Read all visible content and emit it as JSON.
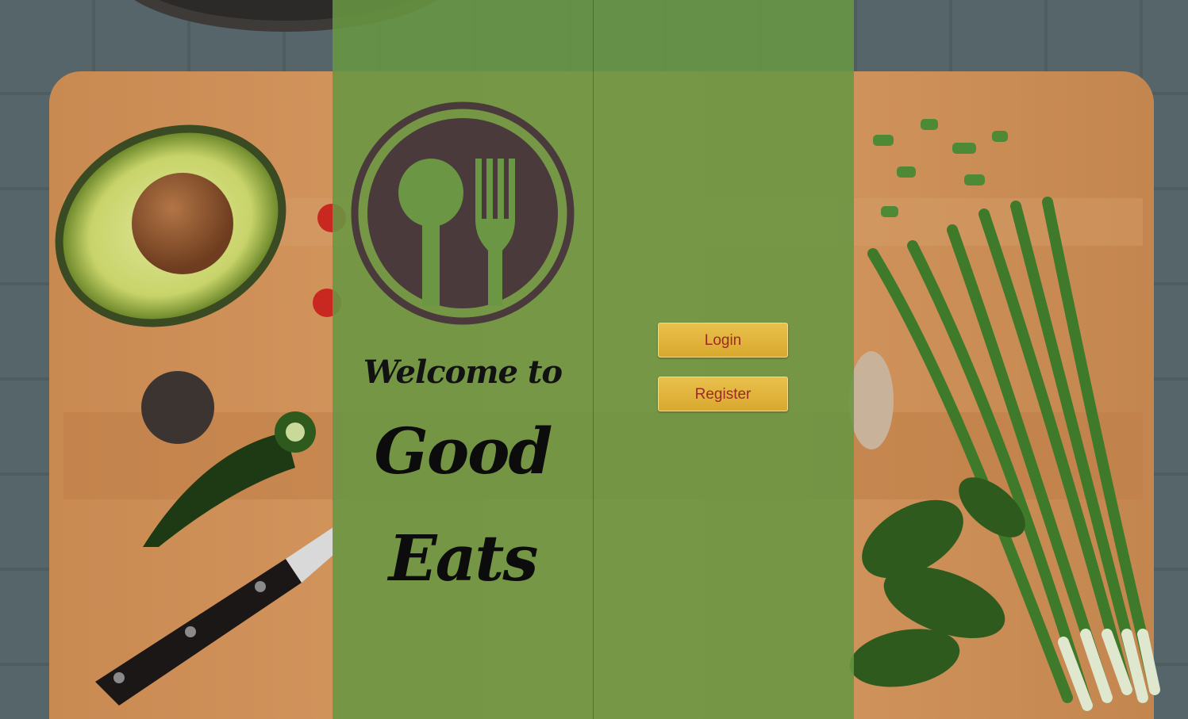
{
  "welcome": {
    "greeting": "Welcome to",
    "brand_line1": "Good",
    "brand_line2": "Eats"
  },
  "logo": {
    "icon": "spoon-fork-icon",
    "color": "#4a3a3c"
  },
  "actions": {
    "login_label": "Login",
    "register_label": "Register"
  },
  "colors": {
    "panel": "#689642",
    "button": "#e2b53d",
    "button_text": "#9e2a25"
  }
}
